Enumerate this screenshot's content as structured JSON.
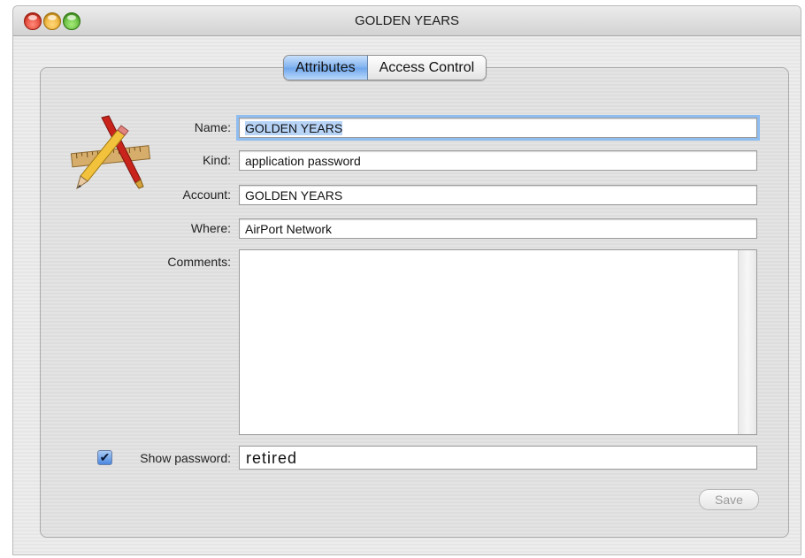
{
  "window": {
    "title": "GOLDEN YEARS"
  },
  "tabs": [
    {
      "label": "Attributes",
      "selected": true
    },
    {
      "label": "Access Control",
      "selected": false
    }
  ],
  "form": {
    "name_label": "Name:",
    "name_value": "GOLDEN YEARS",
    "kind_label": "Kind:",
    "kind_value": "application password",
    "account_label": "Account:",
    "account_value": "GOLDEN YEARS",
    "where_label": "Where:",
    "where_value": "AirPort Network",
    "comments_label": "Comments:",
    "comments_value": "",
    "show_password_label": "Show password:",
    "show_password_checked": true,
    "password_value": "retired",
    "save_label": "Save"
  },
  "icons": {
    "app_icon": "pencil-ruler-icon",
    "checkmark": "✔"
  },
  "colors": {
    "focus_ring": "#8fbdf0",
    "tab_selected": "#7fb1ef"
  }
}
